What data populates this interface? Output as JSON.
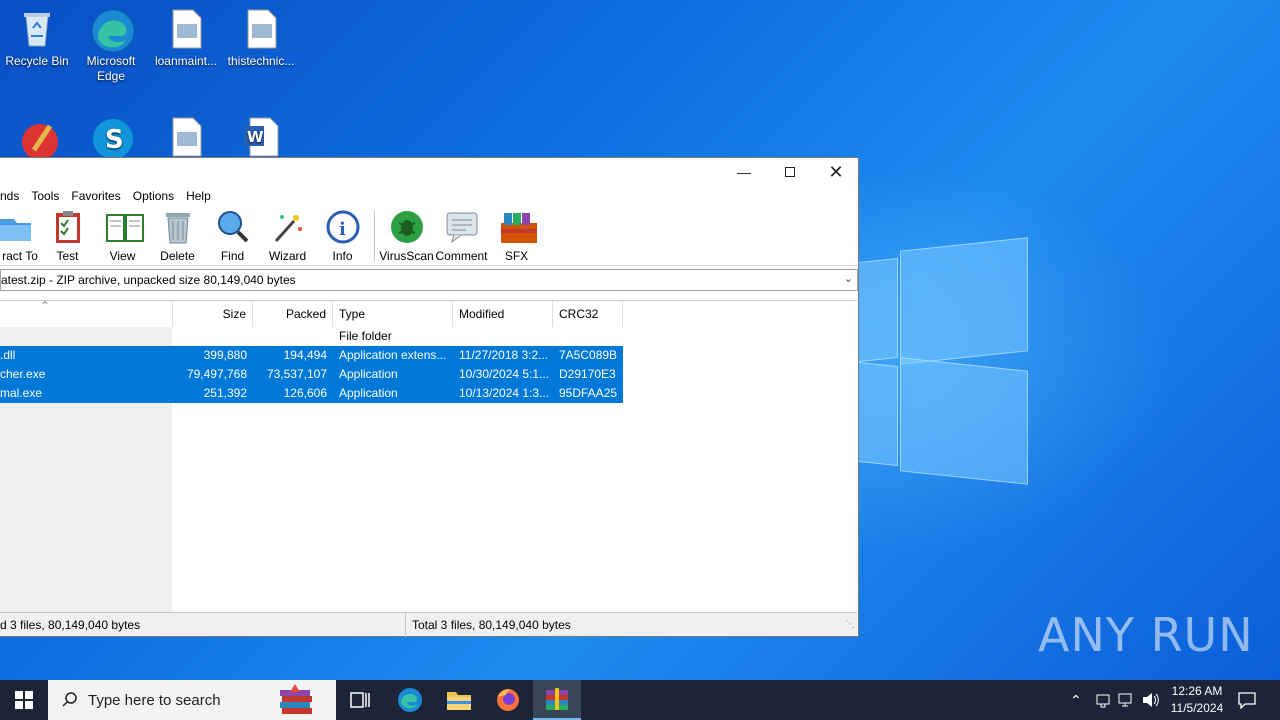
{
  "desktop": {
    "icons": [
      {
        "label": "Recycle Bin"
      },
      {
        "label": "Microsoft Edge"
      },
      {
        "label": "loanmaint..."
      },
      {
        "label": "thistechnic..."
      }
    ]
  },
  "window": {
    "menu": [
      "nds",
      "Tools",
      "Favorites",
      "Options",
      "Help"
    ],
    "toolbar": [
      "ract To",
      "Test",
      "View",
      "Delete",
      "Find",
      "Wizard",
      "Info",
      "VirusScan",
      "Comment",
      "SFX"
    ],
    "path": "atest.zip - ZIP archive, unpacked size 80,149,040 bytes",
    "columns": [
      "Size",
      "Packed",
      "Type",
      "Modified",
      "CRC32"
    ],
    "rows": [
      {
        "name": "",
        "size": "",
        "packed": "",
        "type": "File folder",
        "modified": "",
        "crc": ""
      },
      {
        "name": ".dll",
        "size": "399,880",
        "packed": "194,494",
        "type": "Application extens...",
        "modified": "11/27/2018 3:2...",
        "crc": "7A5C089B"
      },
      {
        "name": "cher.exe",
        "size": "79,497,768",
        "packed": "73,537,107",
        "type": "Application",
        "modified": "10/30/2024 5:1...",
        "crc": "D29170E3"
      },
      {
        "name": "mal.exe",
        "size": "251,392",
        "packed": "126,606",
        "type": "Application",
        "modified": "10/13/2024 1:3...",
        "crc": "95DFAA25"
      }
    ],
    "status_left": "d 3 files, 80,149,040 bytes",
    "status_right": "Total 3 files, 80,149,040 bytes"
  },
  "watermark": "ANY RUN",
  "taskbar": {
    "search_placeholder": "Type here to search",
    "time": "12:26 AM",
    "date": "11/5/2024"
  },
  "colors": {
    "selection": "#0078d7",
    "taskbar": "#1b2537"
  }
}
